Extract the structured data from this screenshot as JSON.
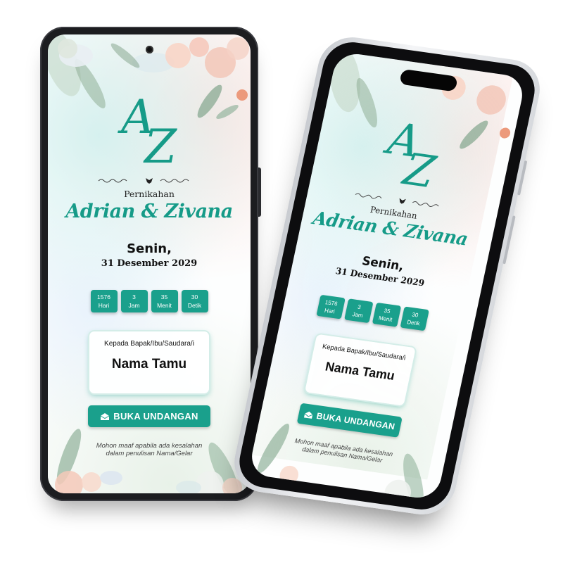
{
  "invitation": {
    "monogram": "AZ",
    "pre_title": "Pernikahan",
    "couple": "Adrian & Zivana",
    "day": "Senin,",
    "date": "31 Desember 2029",
    "countdown": [
      {
        "value": "1576",
        "unit": "Hari"
      },
      {
        "value": "3",
        "unit": "Jam"
      },
      {
        "value": "35",
        "unit": "Menit"
      },
      {
        "value": "30",
        "unit": "Detik"
      }
    ],
    "guest_label": "Kepada Bapak/Ibu/Saudara/i",
    "guest_name": "Nama Tamu",
    "open_button": "BUKA UNDANGAN",
    "note_line1": "Mohon maaf apabila ada kesalahan",
    "note_line2": "dalam penulisan Nama/Gelar"
  },
  "colors": {
    "accent": "#1aa08c",
    "text": "#111111"
  },
  "icons": {
    "open_button_icon": "envelope-open-icon",
    "divider_icon": "bird-icon"
  }
}
